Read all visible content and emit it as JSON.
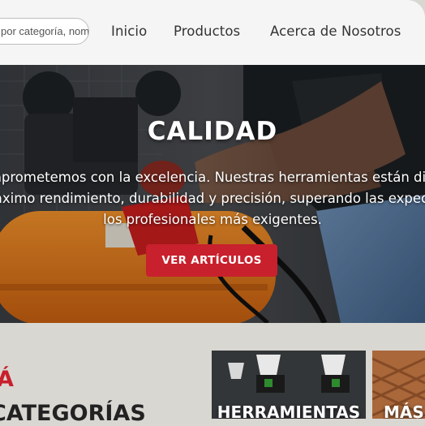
{
  "header": {
    "search_placeholder": "por categoría, nombre...",
    "nav": [
      "Inicio",
      "Productos",
      "Acerca de Nosotros"
    ]
  },
  "hero": {
    "title": "CALIDAD",
    "lines": [
      "Nos comprometemos con la excelencia. Nuestras herramientas están diseñadas",
      "para el máximo rendimiento, durabilidad y precisión, superando las expectativas de",
      "los profesionales más exigentes."
    ],
    "button": "VER ARTÍCULOS"
  },
  "categories": {
    "accent": "Á",
    "heading": "CATEGORÍAS",
    "cards": [
      {
        "label": "HERRAMIENTAS"
      },
      {
        "label": "MÁS"
      }
    ]
  },
  "colors": {
    "accent_red": "#c8202c",
    "header_bg": "#f5f5f5",
    "section_bg": "#d9d7d2"
  }
}
